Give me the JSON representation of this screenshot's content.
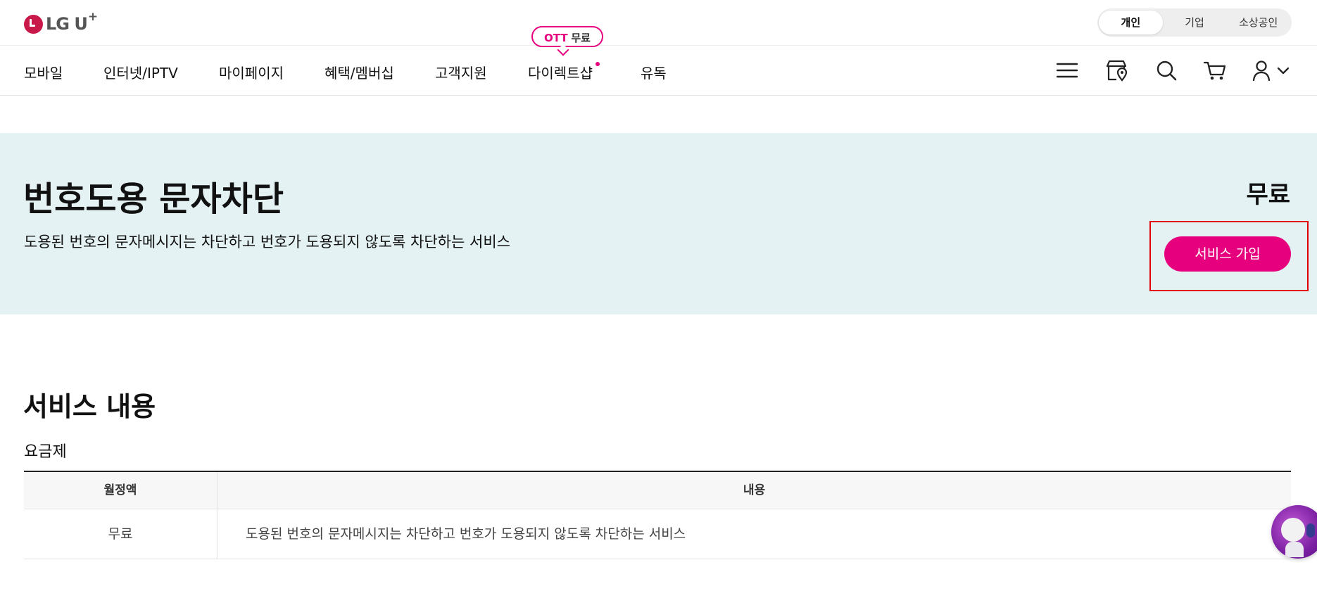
{
  "brand": {
    "logo_text": "LG U",
    "logo_plus": "+"
  },
  "segments": [
    {
      "label": "개인",
      "active": true
    },
    {
      "label": "기업",
      "active": false
    },
    {
      "label": "소상공인",
      "active": false
    }
  ],
  "nav": {
    "items": [
      {
        "label": "모바일"
      },
      {
        "label": "인터넷/IPTV"
      },
      {
        "label": "마이페이지"
      },
      {
        "label": "혜택/멤버십"
      },
      {
        "label": "고객지원"
      },
      {
        "label": "다이렉트샵",
        "dot": true
      },
      {
        "label": "유독"
      }
    ],
    "badge": {
      "ott": "OTT",
      "free": "무료"
    },
    "icons": [
      "menu-icon",
      "store-icon",
      "search-icon",
      "cart-icon",
      "user-icon",
      "chevron-down-icon"
    ]
  },
  "hero": {
    "title": "번호도용 문자차단",
    "description": "도용된 번호의 문자메시지는 차단하고 번호가 도용되지 않도록 차단하는 서비스",
    "price": "무료",
    "join_button": "서비스 가입"
  },
  "content": {
    "section_title": "서비스 내용",
    "sub_title": "요금제",
    "table": {
      "headers": [
        "월정액",
        "내용"
      ],
      "rows": [
        [
          "무료",
          "도용된 번호의 문자메시지는 차단하고 번호가 도용되지 않도록 차단하는 서비스"
        ]
      ]
    }
  },
  "colors": {
    "accent": "#e6007e",
    "hero_bg": "#e4f2f3",
    "highlight_border": "#e0000b"
  }
}
